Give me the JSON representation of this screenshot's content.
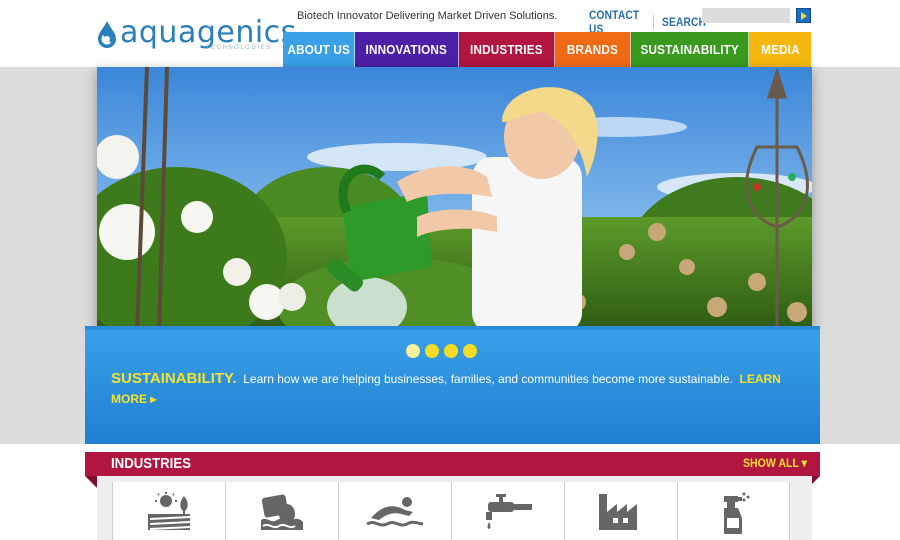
{
  "header": {
    "logo_text": "aquagenics",
    "logo_subtext": "TECHNOLOGIES",
    "tagline": "Biotech Innovator Delivering Market Driven Solutions.",
    "contact_label": "CONTACT US",
    "search_label": "SEARCH",
    "search_value": ""
  },
  "nav": {
    "items": [
      {
        "label": "ABOUT US",
        "color": "#3aa0e8"
      },
      {
        "label": "INNOVATIONS",
        "color": "#4b1fa6"
      },
      {
        "label": "INDUSTRIES",
        "color": "#b0163f"
      },
      {
        "label": "BRANDS",
        "color": "#f06a14"
      },
      {
        "label": "SUSTAINABILITY",
        "color": "#3a9a1f"
      },
      {
        "label": "MEDIA",
        "color": "#f6b80f"
      }
    ]
  },
  "hero": {
    "image": "girl-watering-garden-photo",
    "slide_count": 4,
    "active_slide": 1,
    "caption_heading": "SUSTAINABILITY.",
    "caption_text": "Learn how we are helping businesses, families, and communities become more sustainable.",
    "caption_link": "LEARN MORE ▸"
  },
  "industries": {
    "title": "INDUSTRIES",
    "show_all_label": "SHOW ALL ▾",
    "icons": [
      "agriculture-icon",
      "wastewater-icon",
      "swimming-icon",
      "water-faucet-icon",
      "industrial-factory-icon",
      "cleaning-spray-icon"
    ]
  },
  "colors": {
    "brand_blue": "#2b7fb8",
    "caption_blue": "#2a8ddc",
    "accent_yellow": "#f4e12e",
    "industries_red": "#b0163f"
  }
}
